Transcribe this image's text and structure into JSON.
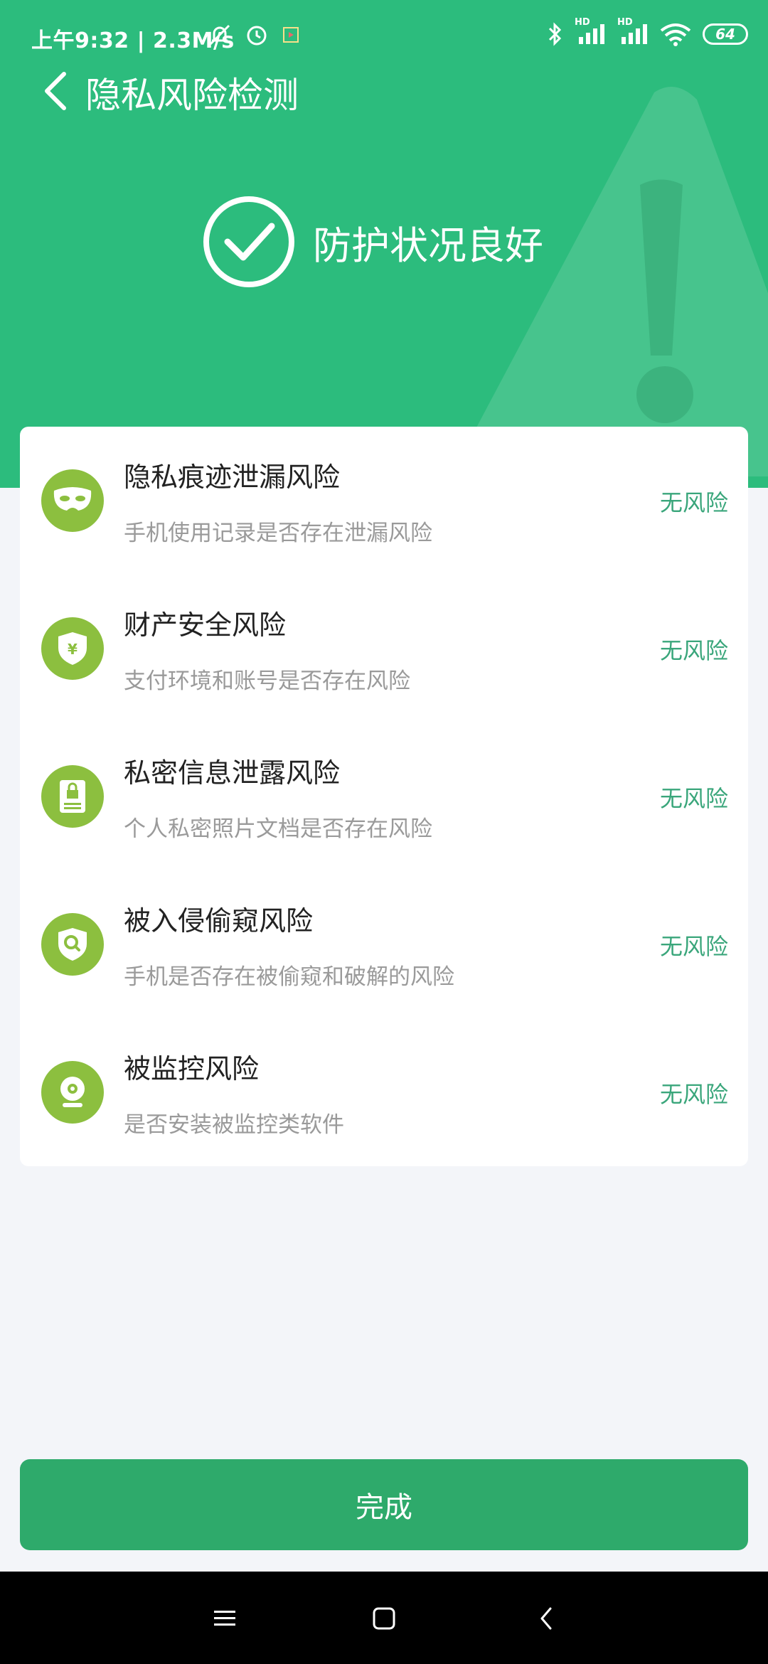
{
  "status_bar": {
    "time": "上午9:32 | 2.3M/s",
    "battery": "64",
    "signal_label_1": "HD",
    "signal_label_2": "HD"
  },
  "header": {
    "title": "隐私风险检测",
    "status": "防护状况良好"
  },
  "risks": [
    {
      "title": "隐私痕迹泄漏风险",
      "desc": "手机使用记录是否存在泄漏风险",
      "status": "无风险",
      "icon": "mask-icon"
    },
    {
      "title": "财产安全风险",
      "desc": "支付环境和账号是否存在风险",
      "status": "无风险",
      "icon": "yen-shield-icon"
    },
    {
      "title": "私密信息泄露风险",
      "desc": "个人私密照片文档是否存在风险",
      "status": "无风险",
      "icon": "lock-document-icon"
    },
    {
      "title": "被入侵偷窥风险",
      "desc": "手机是否存在被偷窥和破解的风险",
      "status": "无风险",
      "icon": "search-shield-icon"
    },
    {
      "title": "被监控风险",
      "desc": "是否安装被监控类软件",
      "status": "无风险",
      "icon": "camera-icon"
    }
  ],
  "done_label": "完成",
  "colors": {
    "header_green": "#2cbc7d",
    "icon_green": "#8cbf3f",
    "status_green": "#3aa67b",
    "button_green": "#2eaa6b"
  }
}
